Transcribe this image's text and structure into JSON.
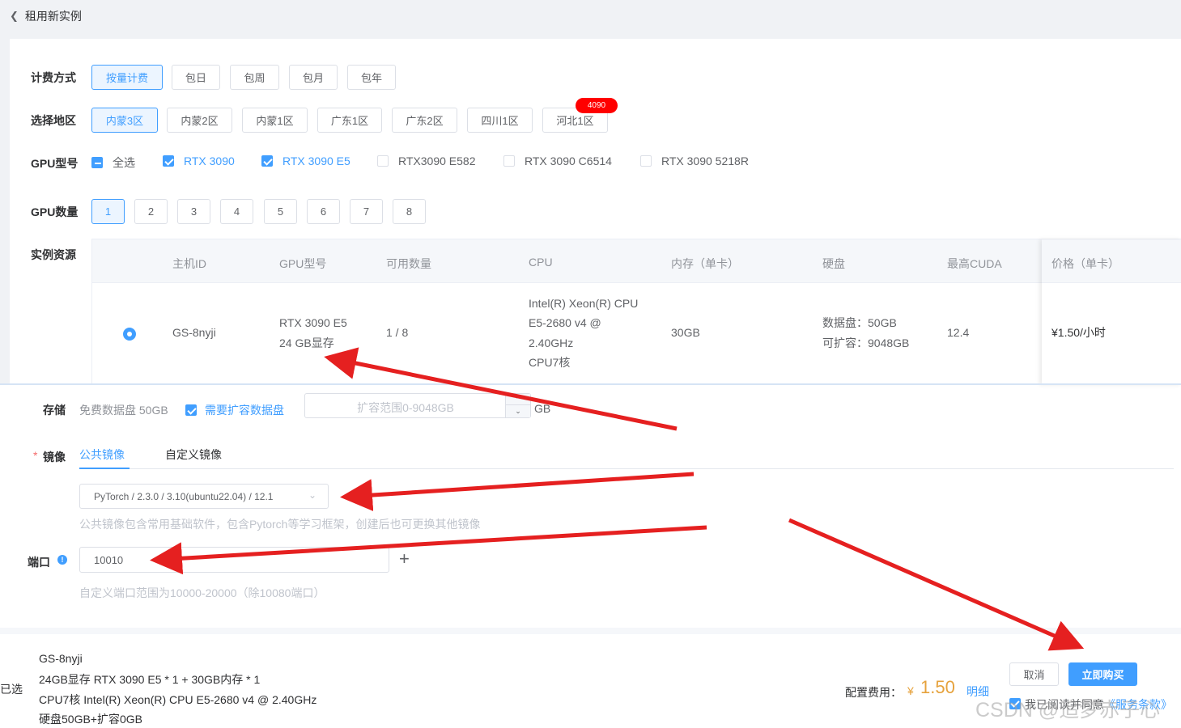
{
  "header": {
    "back_label": "租用新实例"
  },
  "billing": {
    "label": "计费方式",
    "options": [
      "按量计费",
      "包日",
      "包周",
      "包月",
      "包年"
    ],
    "selected": 0
  },
  "region": {
    "label": "选择地区",
    "options": [
      "内蒙3区",
      "内蒙2区",
      "内蒙1区",
      "广东1区",
      "广东2区",
      "四川1区",
      "河北1区"
    ],
    "selected": 0,
    "badge": "4090"
  },
  "gpu_model": {
    "label": "GPU型号",
    "options": [
      {
        "label": "全选",
        "state": "indeterminate"
      },
      {
        "label": "RTX 3090",
        "state": "checked"
      },
      {
        "label": "RTX 3090 E5",
        "state": "checked"
      },
      {
        "label": "RTX3090 E582",
        "state": "unchecked"
      },
      {
        "label": "RTX 3090 C6514",
        "state": "unchecked"
      },
      {
        "label": "RTX 3090 5218R",
        "state": "unchecked"
      }
    ]
  },
  "gpu_count": {
    "label": "GPU数量",
    "options": [
      "1",
      "2",
      "3",
      "4",
      "5",
      "6",
      "7",
      "8"
    ],
    "selected": 0
  },
  "instances": {
    "label": "实例资源",
    "columns": [
      "主机ID",
      "GPU型号",
      "可用数量",
      "CPU",
      "内存（单卡）",
      "硬盘",
      "最高CUDA",
      "价格（单卡）"
    ],
    "row": {
      "host_id": "GS-8nyji",
      "gpu_line1": "RTX 3090 E5",
      "gpu_line2": "24 GB显存",
      "available": "1 / 8",
      "cpu_line1": "Intel(R) Xeon(R) CPU",
      "cpu_line2": "E5-2680 v4 @",
      "cpu_line3": "2.40GHz",
      "cpu_line4": "CPU7核",
      "memory": "30GB",
      "disk_line1": "数据盘：50GB",
      "disk_line2": "可扩容：9048GB",
      "cuda": "12.4",
      "price": "¥1.50/小时"
    }
  },
  "storage": {
    "label": "存储",
    "free": "免费数据盘 50GB",
    "expand_label": "需要扩容数据盘",
    "expand_placeholder": "扩容范围0-9048GB",
    "unit": "GB"
  },
  "image": {
    "required_mark": "*",
    "label": "镜像",
    "tabs": [
      "公共镜像",
      "自定义镜像"
    ],
    "selected_value": "PyTorch / 2.3.0 / 3.10(ubuntu22.04) / 12.1",
    "hint": "公共镜像包含常用基础软件，包含Pytorch等学习框架，创建后也可更换其他镜像"
  },
  "port": {
    "label": "端口",
    "info_icon": "!",
    "value": "10010",
    "add_icon": "+",
    "hint": "自定义端口范围为10000-20000（除10080端口）"
  },
  "footer": {
    "selected_label": "已选",
    "summary": [
      "GS-8nyji",
      "24GB显存 RTX 3090 E5 * 1 + 30GB内存 * 1",
      "CPU7核 Intel(R) Xeon(R) CPU E5-2680 v4 @ 2.40GHz",
      "硬盘50GB+扩容0GB"
    ],
    "cost_label": "配置费用：",
    "currency": "¥",
    "cost": "1.50",
    "detail_link": "明细",
    "cancel": "取消",
    "buy": "立即购买",
    "agree_text": "我已阅读并同意",
    "agree_link": "《服务条款》",
    "watermark": "CSDN @追梦赤子心"
  },
  "colors": {
    "primary": "#409eff",
    "price": "#e6a23c",
    "annotation_arrow": "#e52020",
    "badge": "#ff0000"
  }
}
